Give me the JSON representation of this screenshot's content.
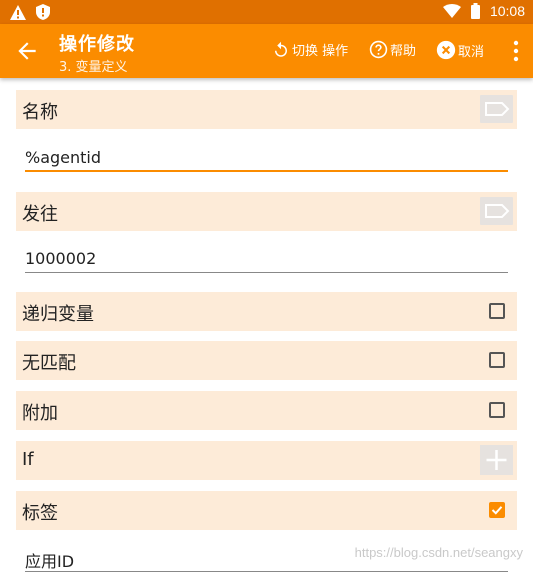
{
  "status": {
    "time": "10:08",
    "icons": [
      "warning-icon",
      "shield-icon",
      "wifi-icon",
      "battery-icon"
    ]
  },
  "appbar": {
    "title": "操作修改",
    "subtitle": "3. 变量定义",
    "actions": {
      "switch_label": "切换 操作",
      "help_label": "帮助",
      "cancel_label": "取消"
    }
  },
  "form": {
    "name": {
      "label": "名称",
      "value": "%agentid"
    },
    "send_to": {
      "label": "发往",
      "value": "1000002"
    },
    "recursive": {
      "label": "递归变量",
      "checked": false
    },
    "no_match": {
      "label": "无匹配",
      "checked": false
    },
    "append": {
      "label": "附加",
      "checked": false
    },
    "if": {
      "label": "If"
    },
    "tag": {
      "label": "标签",
      "checked": true,
      "value": "应用ID"
    }
  },
  "watermark": "https://blog.csdn.net/seangxy",
  "colors": {
    "accent": "#fb8c00",
    "statusbar": "#e07000",
    "row_bg": "#fdebd8"
  }
}
